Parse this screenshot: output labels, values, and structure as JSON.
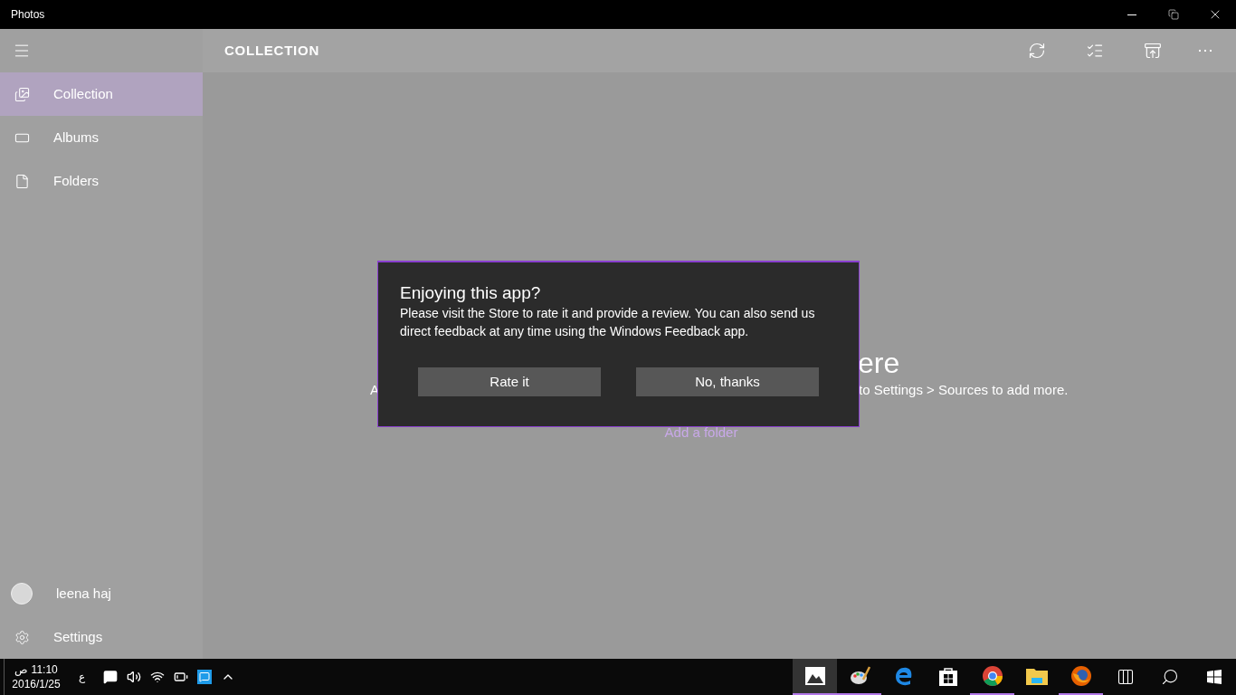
{
  "window": {
    "title": "Photos"
  },
  "header": {
    "title": "COLLECTION"
  },
  "nav": [
    {
      "kind": "collection",
      "label": "Collection",
      "selected": true
    },
    {
      "kind": "albums",
      "label": "Albums",
      "selected": false
    },
    {
      "kind": "folders",
      "label": "Folders",
      "selected": false
    }
  ],
  "account": {
    "name": "leena haj"
  },
  "settings": {
    "label": "Settings"
  },
  "background": {
    "heading_fragment": "ere",
    "line_fragment_start": "A",
    "line_fragment_end": "to Settings > Sources to add more.",
    "link": "Add a folder"
  },
  "dialog": {
    "title": "Enjoying this app?",
    "message": "Please visit the Store to rate it and provide a review. You can also send us direct feedback at any time using the Windows Feedback app.",
    "buttons": [
      "Rate it",
      "No, thanks"
    ]
  },
  "taskbar": {
    "time": "11:10 ص",
    "date": "2016/1/25",
    "input_indicator": "ع",
    "apps": [
      {
        "kind": "photos",
        "selected": true,
        "running": true
      },
      {
        "kind": "paint",
        "selected": false,
        "running": true
      },
      {
        "kind": "edge",
        "selected": false,
        "running": false
      },
      {
        "kind": "store",
        "selected": false,
        "running": false
      },
      {
        "kind": "chrome",
        "selected": false,
        "running": true
      },
      {
        "kind": "explorer",
        "selected": false,
        "running": false
      },
      {
        "kind": "firefox",
        "selected": false,
        "running": true
      }
    ]
  }
}
